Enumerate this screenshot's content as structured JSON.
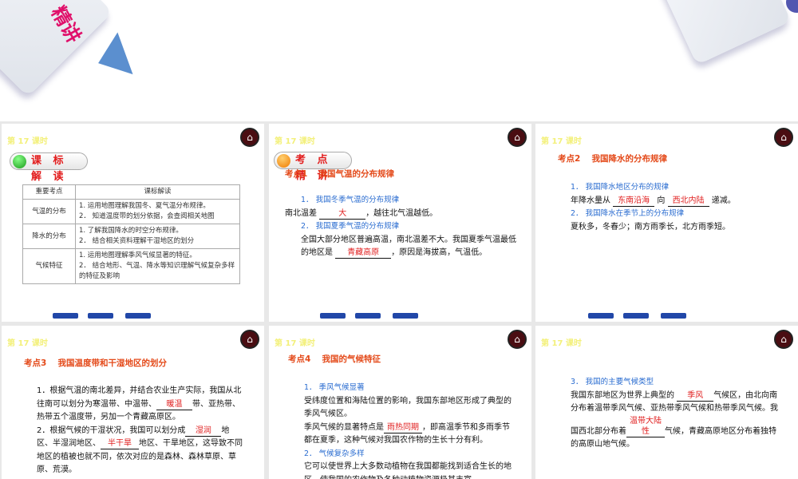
{
  "banner": {
    "title": "精讲"
  },
  "lesson_label": "第 17 课时",
  "slide1": {
    "badge": "课 标 解 读",
    "headers": [
      "重要考点",
      "课标解读"
    ],
    "rows": [
      {
        "topic": "气温的分布",
        "items": [
          "1. 运用地图理解我国冬、夏气温分布规律。",
          "2． 知道温度带的划分依据，会查阅相关地图"
        ]
      },
      {
        "topic": "降水的分布",
        "items": [
          "1. 了解我国降水的时空分布规律。",
          "2． 结合相关资料理解干湿地区的划分"
        ]
      },
      {
        "topic": "气候特征",
        "items": [
          "1. 运用地图理解季风气候显著的特征。",
          "2． 结合地形、气温、降水等知识理解气候复杂多样的特征及影响"
        ]
      }
    ]
  },
  "slide2": {
    "badge": "考 点 精 讲",
    "heading": "考点1　 我国气温的分布规律",
    "sub1": "1． 我国冬季气温的分布规律",
    "l1a": "南北温差",
    "a1": "大",
    "l1b": "，越往北气温越低。",
    "sub2": "2． 我国夏季气温的分布规律",
    "p2a": "全国大部分地区普遍高温，南北温差不大。我国夏季气温最低的地区是",
    "a2": "青藏高原",
    "p2b": "，原因是海拔高，气温低。"
  },
  "slide3": {
    "heading": "考点2　 我国降水的分布规律",
    "sub1": "1． 我国降水地区分布的规律",
    "l1a": "年降水量从",
    "a1": "东南沿海",
    "l1b": "向",
    "a2": "西北内陆",
    "l1c": "递减。",
    "sub2": "2． 我国降水在季节上的分布规律",
    "l2": "夏秋多，冬春少；南方雨季长，北方雨季短。"
  },
  "slide4": {
    "heading": "考点3　 我国温度带和干湿地区的划分",
    "p1a": "1．根据气温的南北差异，并结合农业生产实际，我国从北往南可以划分为寒温带、中温带、",
    "a1": "暖温",
    "p1b": "带、亚热带、热带五个温度带，另加一个青藏高原区。",
    "p2a": "2．根据气候的干湿状况，我国可以划分成",
    "a2": "湿润",
    "p2b": "地区、半湿润地区、",
    "a3": "半干旱",
    "p2c": "地区、干旱地区，这导致不同地区的植被也就不同，依次对应的是森林、森林草原、草原、荒漠。"
  },
  "slide5": {
    "heading": "考点4　 我国的气候特征",
    "sub1": "1． 季风气候显著",
    "p1": "受纬度位置和海陆位置的影响，我国东部地区形成了典型的季风气候区。",
    "p2a": "季风气候的显著特点是",
    "a1": "雨热同期",
    "p2b": "，即高温季节和多雨季节都在夏季，这种气候对我国农作物的生长十分有利。",
    "sub2": "2． 气候复杂多样",
    "p3": "它可以使世界上大多数动植物在我国都能找到适合生长的地区，使我国的农作物及各种动植物资源极其丰富。"
  },
  "slide6": {
    "sub": "3． 我国的主要气候类型",
    "pa": "我国东部地区为世界上典型的",
    "a1": "季风",
    "pb": "气候区，由北向南分布着温带季风气候、亚热带季风气候和热带季风气候。我国西北部分布着",
    "a2": "温带大陆性",
    "pc": "气候，青藏高原地区分布着独特的高原山地气候。"
  },
  "icons": {
    "home": "⌂"
  },
  "colors": {
    "answer": "#e02020",
    "heading": "#e44a1a",
    "sub": "#2a6cd0",
    "lesson": "#f3f07a"
  }
}
